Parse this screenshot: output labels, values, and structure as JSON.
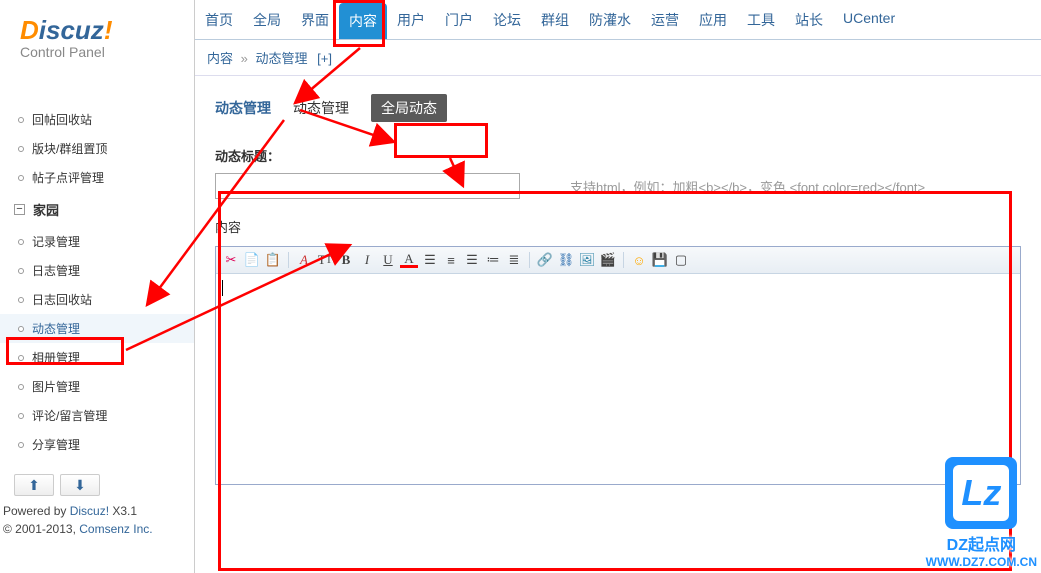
{
  "logo": {
    "d": "D",
    "iscuz": "iscuz",
    "excl": "!",
    "sub": "Control Panel"
  },
  "topnav": {
    "items": [
      "首页",
      "全局",
      "界面",
      "内容",
      "用户",
      "门户",
      "论坛",
      "群组",
      "防灌水",
      "运营",
      "应用",
      "工具",
      "站长",
      "UCenter"
    ],
    "activeIndex": 3
  },
  "breadcrumb": {
    "a": "内容",
    "sep": "»",
    "b": "动态管理",
    "plus": "[+]"
  },
  "tabs": {
    "t0": "动态管理",
    "t1": "动态管理",
    "t2": "全局动态"
  },
  "sidebar": {
    "group1": [
      "回帖回收站",
      "版块/群组置顶",
      "帖子点评管理"
    ],
    "groupLabel": "家园",
    "group2": [
      "记录管理",
      "日志管理",
      "日志回收站",
      "动态管理",
      "相册管理",
      "图片管理",
      "评论/留言管理",
      "分享管理"
    ],
    "activeIndex2": 3
  },
  "form": {
    "titleLabel": "动态标题：",
    "titleValue": "",
    "hint": "支持html，例如：加粗<b></b>，变色 <font color=red></font>",
    "contentLabel": "内容"
  },
  "toolbar_icons": [
    "cut-icon",
    "copy-icon",
    "paste-icon",
    "font-color-icon",
    "font-size-icon",
    "bold-icon",
    "italic-icon",
    "underline-icon",
    "fore-color-icon",
    "align-left-icon",
    "align-center-icon",
    "align-right-icon",
    "ordered-list-icon",
    "unordered-list-icon",
    "link-icon",
    "unlink-icon",
    "image-icon",
    "media-icon",
    "emoji-icon",
    "save-icon",
    "fullscreen-icon"
  ],
  "footer": {
    "line1a": "Powered by ",
    "line1b": "Discuz!",
    "line1c": " X3.1",
    "line2a": "© 2001-2013, ",
    "line2b": "Comsenz Inc."
  },
  "watermark": {
    "logo": "Lz",
    "t1": "DZ起点网",
    "t2": "WWW.DZ7.COM.CN"
  }
}
